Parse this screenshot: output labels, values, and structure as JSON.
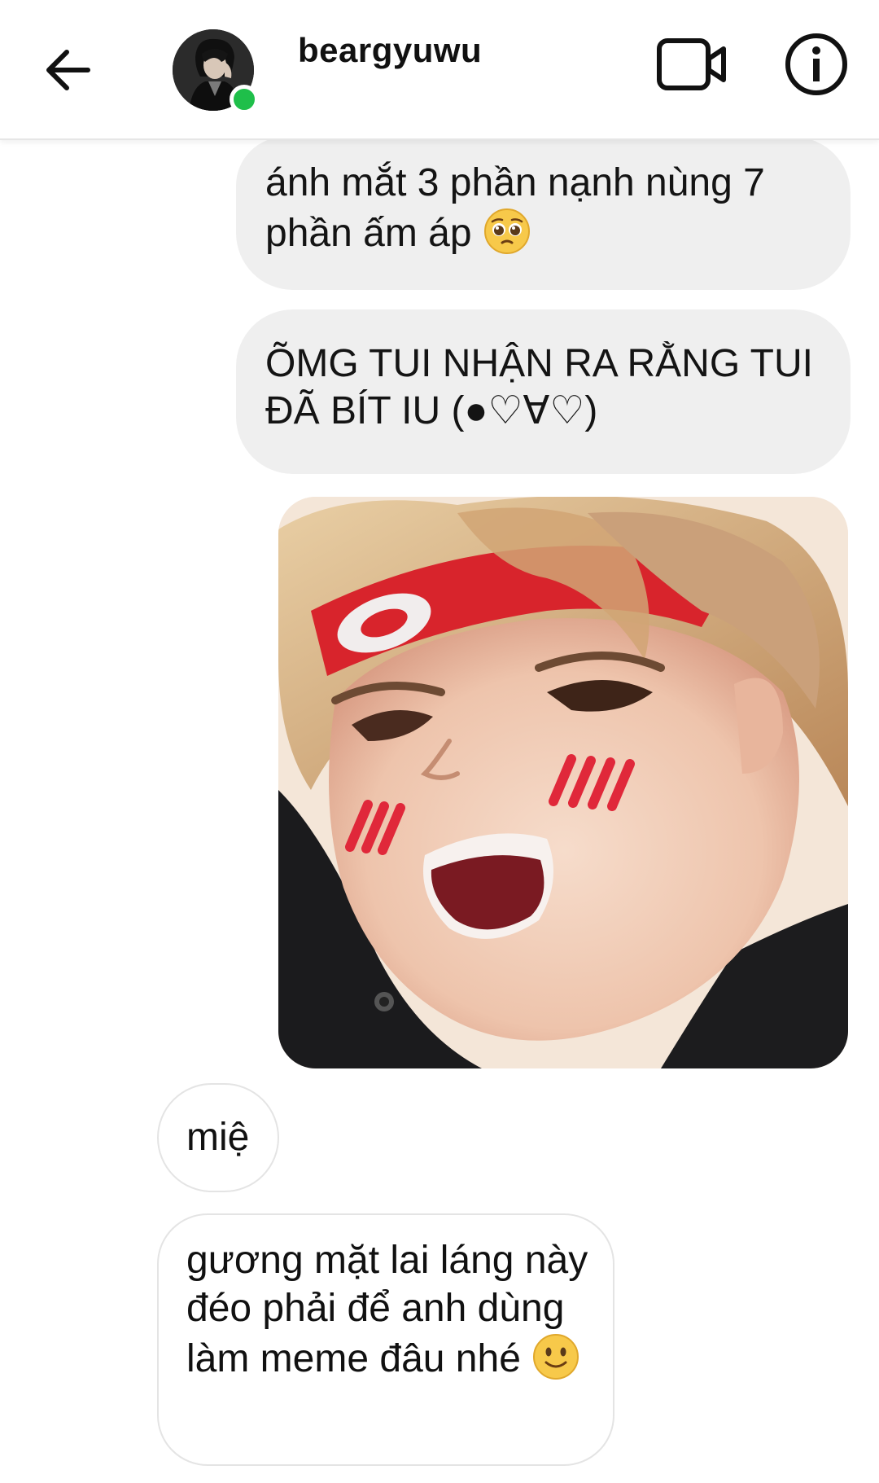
{
  "header": {
    "username": "beargyuwu",
    "online": true,
    "colors": {
      "online_dot": "#1fbf4a",
      "icon": "#111111"
    },
    "icons": {
      "back": "arrow-left-icon",
      "video_call": "video-camera-icon",
      "info": "info-circle-icon"
    }
  },
  "messages": [
    {
      "direction": "sent",
      "text": "ánh mắt 3 phần nạnh nùng 7 phần ấm áp",
      "emoji": "pleading-face-emoji"
    },
    {
      "direction": "sent",
      "text": "ÕMG TUI NHẬN RA RẰNG TUI ĐÃ BÍT IU (●♡∀♡)"
    },
    {
      "direction": "sent",
      "type": "image",
      "content": "photo"
    },
    {
      "direction": "received",
      "text": "miệ"
    },
    {
      "direction": "received",
      "text": "gương mặt lai láng này đéo phải để anh dùng làm meme đâu nhé",
      "emoji": "slightly-smiling-face-emoji"
    }
  ],
  "colors": {
    "sent_bubble": "#efefef",
    "received_border": "#e4e4e4",
    "background": "#ffffff"
  }
}
